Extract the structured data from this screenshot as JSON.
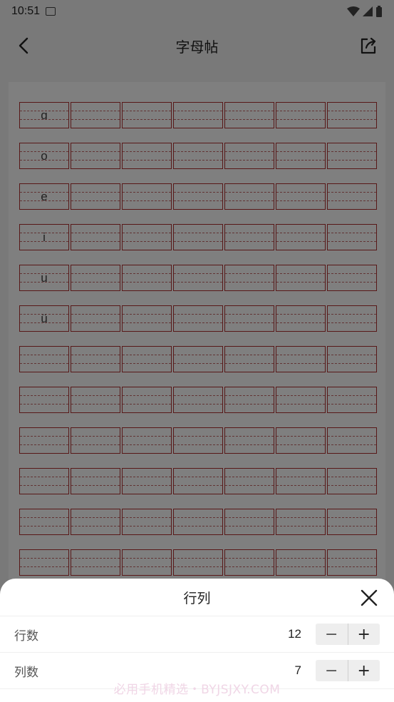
{
  "status": {
    "time": "10:51"
  },
  "header": {
    "title": "字母帖"
  },
  "grid": {
    "letters": [
      "ɑ",
      "o",
      "e",
      "i",
      "u",
      "ü",
      "",
      "",
      "",
      "",
      "",
      ""
    ],
    "rows": 12,
    "cols": 7,
    "line_color": "#b03030"
  },
  "sheet": {
    "title": "行列",
    "rows_label": "行数",
    "rows_value": "12",
    "cols_label": "列数",
    "cols_value": "7",
    "minus": "−",
    "plus": "+"
  },
  "watermark": "必用手机精选・BYJSJXY.COM"
}
